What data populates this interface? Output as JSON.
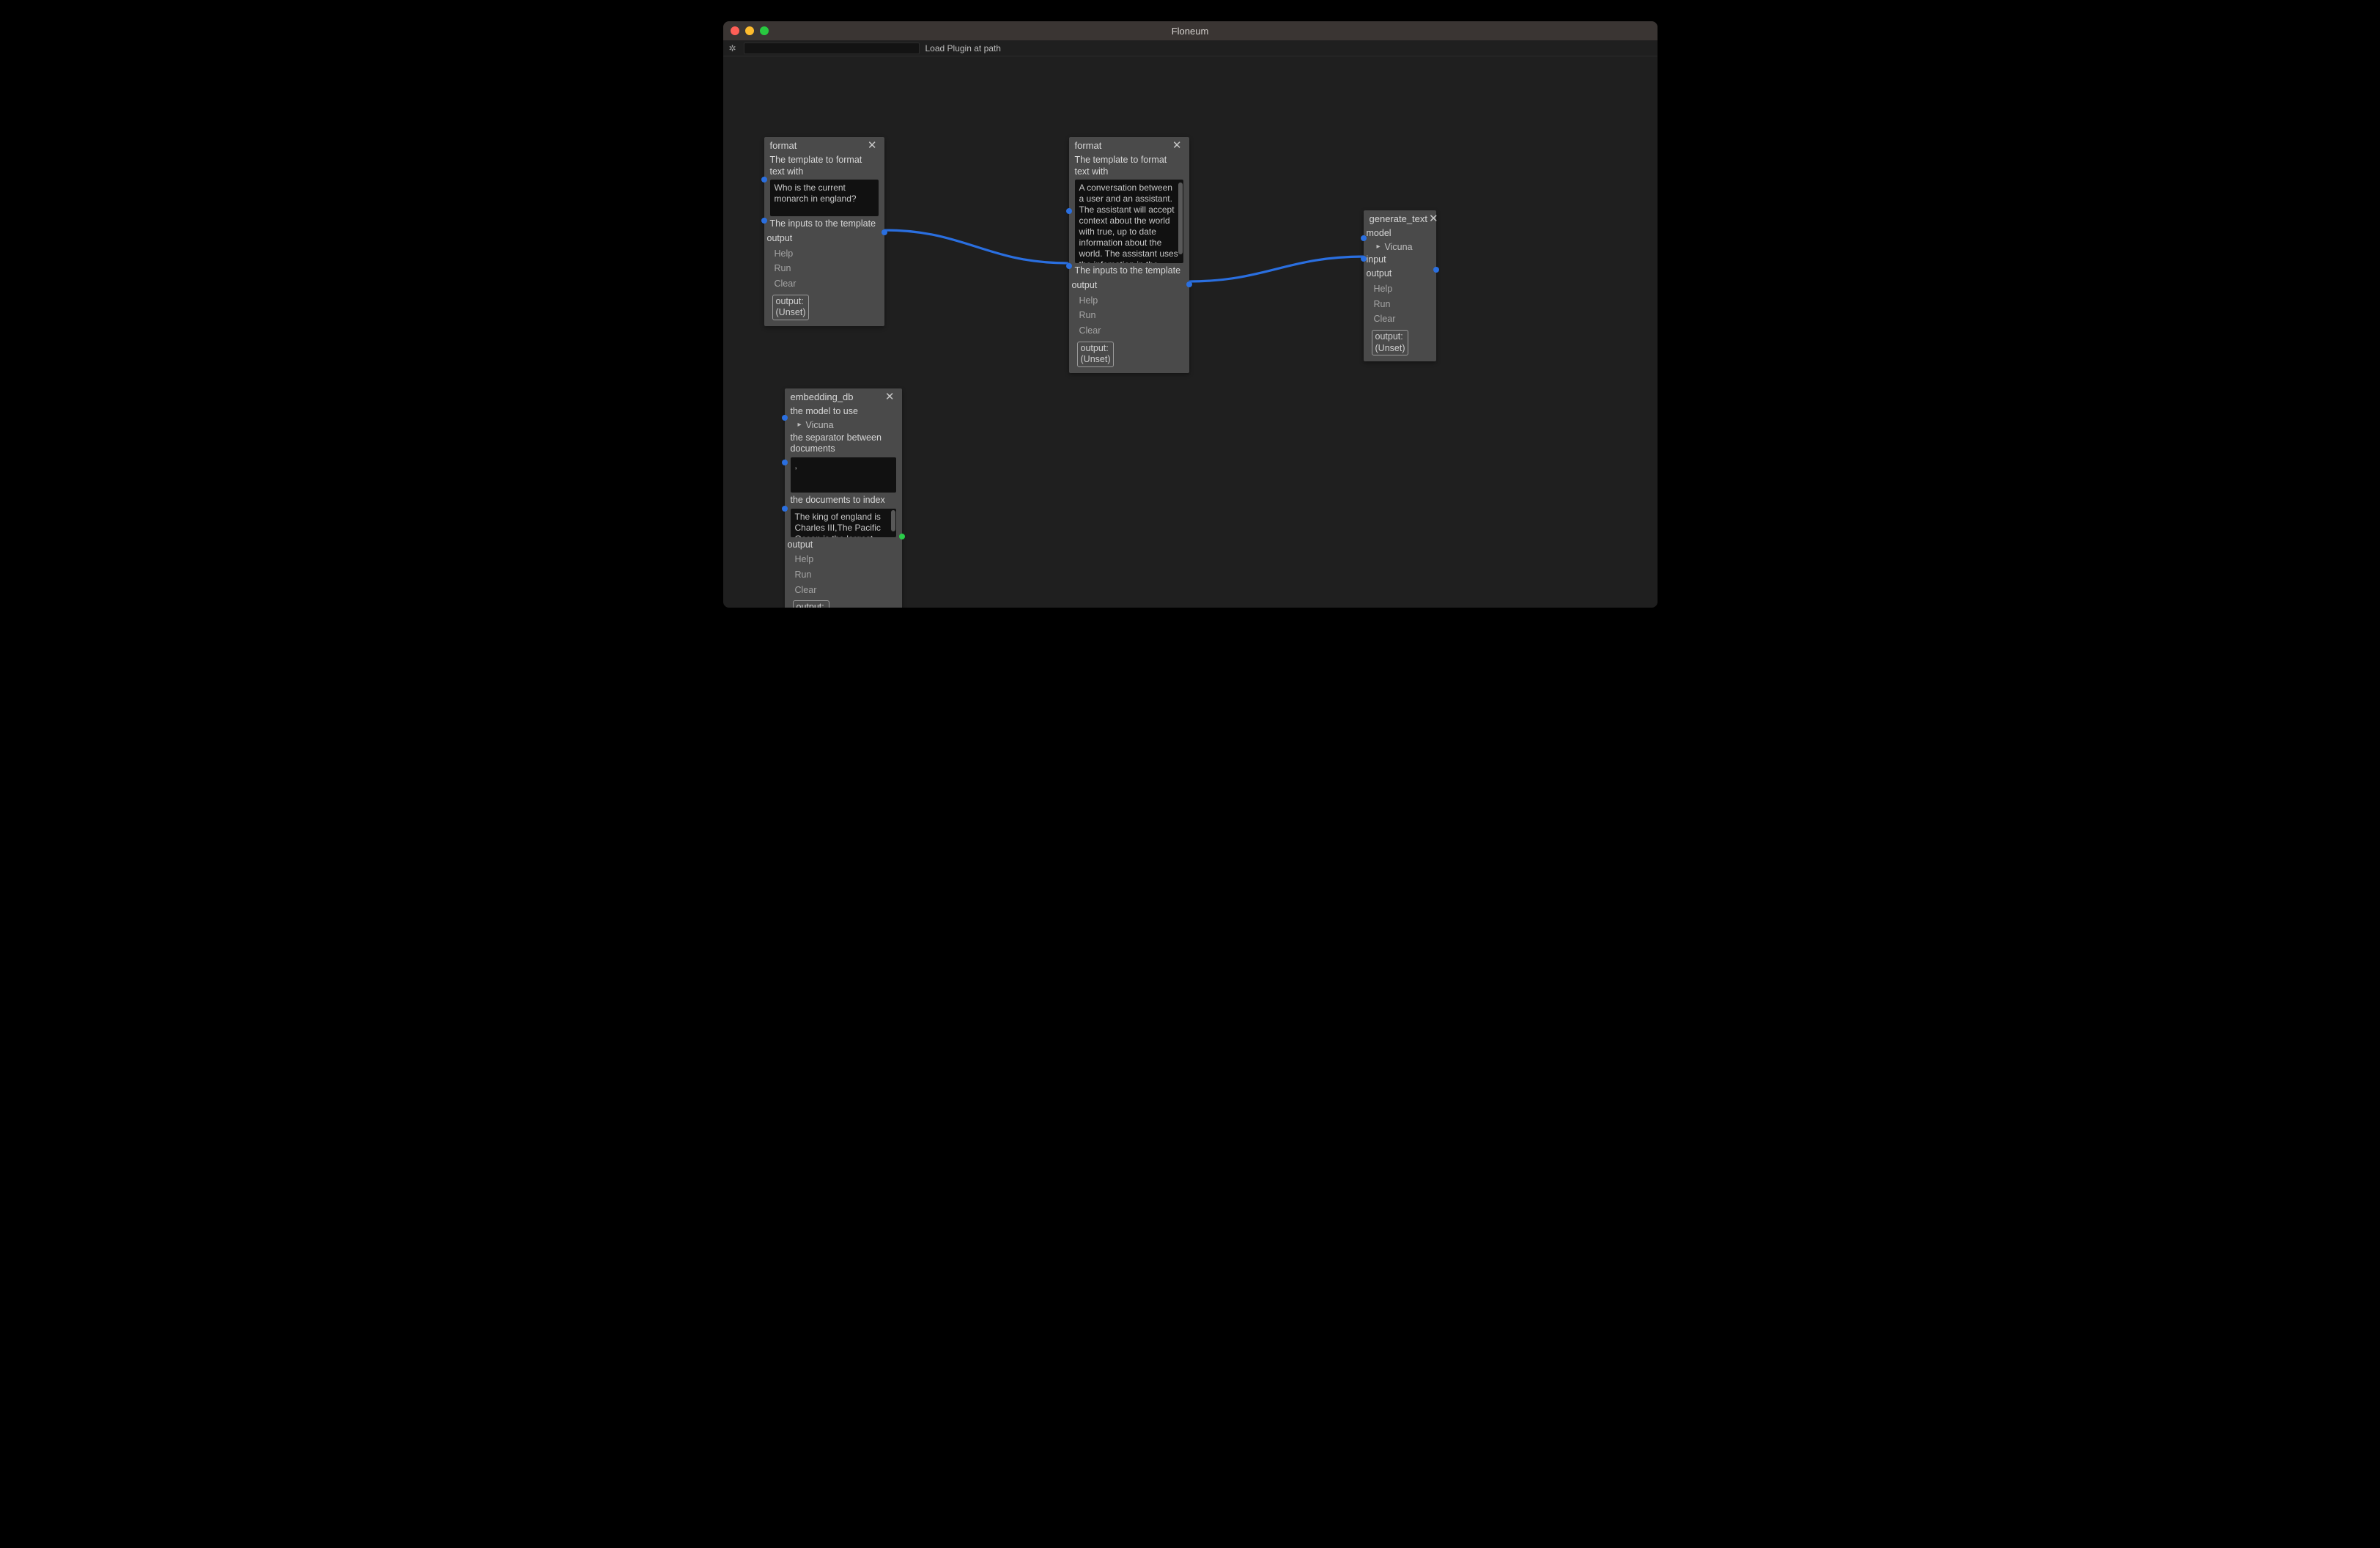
{
  "window": {
    "title": "Floneum"
  },
  "toolbar": {
    "load_plugin_label": "Load Plugin at path"
  },
  "actions": {
    "help": "Help",
    "run": "Run",
    "clear": "Clear"
  },
  "output_box": {
    "status": "output:",
    "value": "(Unset)"
  },
  "nodes": {
    "format1": {
      "title": "format",
      "template_label": "The template to format text with",
      "template_value": "Who is the current monarch in england?",
      "inputs_label": "The inputs to the template",
      "output_label": "output"
    },
    "format2": {
      "title": "format",
      "template_label": "The template to format text with",
      "template_value": "A conversation between a user and an assistant. The assistant will accept context about the world with true, up to date information about the world. The assistant uses the infomation in the context to answer susinctly",
      "inputs_label": "The inputs to the template",
      "output_label": "output"
    },
    "generate_text": {
      "title": "generate_text",
      "model_label": "model",
      "model_value": "Vicuna",
      "input_label": "input",
      "output_label": "output"
    },
    "embedding_db": {
      "title": "embedding_db",
      "model_label": "the model to use",
      "model_value": "Vicuna",
      "separator_label": "the separator between documents",
      "separator_value": ",",
      "documents_label": "the documents to index",
      "documents_value": "The king of england is Charles III,The Pacific Ocean is the largest",
      "output_label": "output"
    }
  }
}
